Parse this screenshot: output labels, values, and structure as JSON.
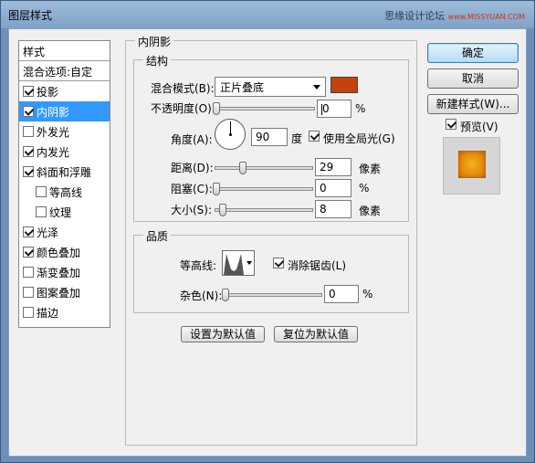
{
  "window": {
    "title": "图层样式",
    "watermark": "思缘设计论坛",
    "watermark_small": "www.MISSYUAN.COM"
  },
  "style_list": {
    "header": "样式",
    "blend_options": "混合选项:自定",
    "items": [
      {
        "label": "投影",
        "checked": true,
        "selected": false,
        "indent": false
      },
      {
        "label": "内阴影",
        "checked": true,
        "selected": true,
        "indent": false
      },
      {
        "label": "外发光",
        "checked": false,
        "selected": false,
        "indent": false
      },
      {
        "label": "内发光",
        "checked": true,
        "selected": false,
        "indent": false
      },
      {
        "label": "斜面和浮雕",
        "checked": true,
        "selected": false,
        "indent": false
      },
      {
        "label": "等高线",
        "checked": false,
        "selected": false,
        "indent": true
      },
      {
        "label": "纹理",
        "checked": false,
        "selected": false,
        "indent": true
      },
      {
        "label": "光泽",
        "checked": true,
        "selected": false,
        "indent": false
      },
      {
        "label": "颜色叠加",
        "checked": true,
        "selected": false,
        "indent": false
      },
      {
        "label": "渐变叠加",
        "checked": false,
        "selected": false,
        "indent": false
      },
      {
        "label": "图案叠加",
        "checked": false,
        "selected": false,
        "indent": false
      },
      {
        "label": "描边",
        "checked": false,
        "selected": false,
        "indent": false
      }
    ]
  },
  "panel": {
    "title": "内阴影",
    "structure": {
      "title": "结构",
      "blend_mode_label": "混合模式(B):",
      "blend_mode_value": "正片叠底",
      "shadow_color": "#c3430b",
      "opacity_label": "不透明度(O):",
      "opacity_value": "0",
      "opacity_unit": "%",
      "angle_label": "角度(A):",
      "angle_value": "90",
      "angle_unit": "度",
      "global_light_label": "使用全局光(G)",
      "global_light_checked": true,
      "distance_label": "距离(D):",
      "distance_value": "29",
      "distance_unit": "像素",
      "choke_label": "阻塞(C):",
      "choke_value": "0",
      "choke_unit": "%",
      "size_label": "大小(S):",
      "size_value": "8",
      "size_unit": "像素"
    },
    "quality": {
      "title": "品质",
      "contour_label": "等高线:",
      "antialias_label": "消除锯齿(L)",
      "antialias_checked": true,
      "noise_label": "杂色(N):",
      "noise_value": "0",
      "noise_unit": "%"
    },
    "make_default_label": "设置为默认值",
    "reset_default_label": "复位为默认值"
  },
  "buttons": {
    "ok": "确定",
    "cancel": "取消",
    "new_style": "新建样式(W)...",
    "preview_label": "预览(V)",
    "preview_checked": true
  }
}
